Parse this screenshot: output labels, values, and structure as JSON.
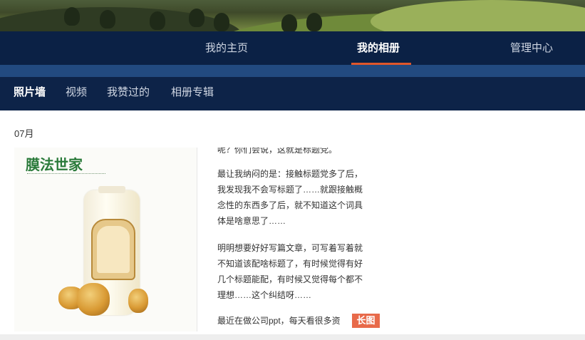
{
  "top_nav": {
    "items": [
      {
        "label": "我的主页"
      },
      {
        "label": "我的相册"
      },
      {
        "label": "管理中心"
      }
    ],
    "active_index": 1
  },
  "sub_nav": {
    "items": [
      {
        "label": "照片墙"
      },
      {
        "label": "视频"
      },
      {
        "label": "我赞过的"
      },
      {
        "label": "相册专辑"
      }
    ],
    "active_index": 0
  },
  "album": {
    "month": "07月",
    "post": {
      "image_brand": "膜法世家",
      "text_top": "呢？你们会说，这就是标题党。",
      "paragraphs": [
        "最让我纳闷的是：接触标题党多了后，我发现我不会写标题了……就跟接触概念性的东西多了后，就不知道这个词具体是啥意思了……",
        "明明想要好好写篇文章，可写着写着就不知道该配啥标题了，有时候觉得有好几个标题能配，有时候又觉得每个都不理想……这个纠结呀……",
        "最近在做公司ppt，每天看很多资"
      ],
      "badge": "长图"
    }
  },
  "colors": {
    "nav_bg": "#0b2145",
    "stripe": "#224a80",
    "accent": "#e0562a",
    "badge_bg": "#e86a4a"
  }
}
